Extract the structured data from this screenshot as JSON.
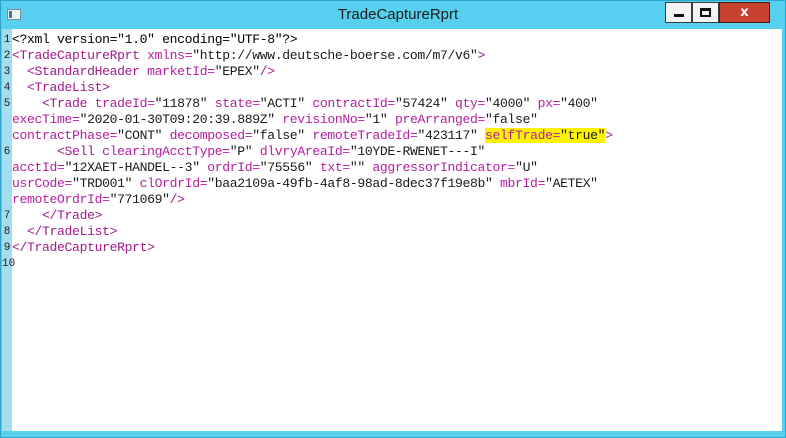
{
  "window": {
    "title": "TradeCaptureRprt",
    "minimize_glyph": "minimize",
    "maximize_glyph": "maximize",
    "close_glyph": "x"
  },
  "editor": {
    "line_numbers": [
      "1",
      "2",
      "3",
      "4",
      "5",
      "6",
      "7",
      "8",
      "9",
      "10"
    ],
    "highlight_color": "#fff200",
    "lines": [
      {
        "text": "<?xml version=\"1.0\" encoding=\"UTF-8\"?>"
      },
      {
        "indent": "",
        "tag": "<TradeCaptureRprt",
        "attrs": [
          [
            "xmlns",
            "http://www.deutsche-boerse.com/m7/v6"
          ]
        ],
        "close": ">"
      },
      {
        "indent": "  ",
        "tag": "<StandardHeader",
        "attrs": [
          [
            "marketId",
            "EPEX"
          ]
        ],
        "close": "/>"
      },
      {
        "indent": "  ",
        "tag": "<TradeList",
        "close": ">"
      },
      {
        "indent": "    ",
        "tag": "<Trade",
        "attrs": [
          [
            "tradeId",
            "11878"
          ],
          [
            "state",
            "ACTI"
          ],
          [
            "contractId",
            "57424"
          ],
          [
            "qty",
            "4000"
          ],
          [
            "px",
            "400"
          ]
        ]
      },
      {
        "attrs": [
          [
            "execTime",
            "2020-01-30T09:20:39.889Z"
          ],
          [
            "revisionNo",
            "1"
          ],
          [
            "preArranged",
            "false"
          ]
        ]
      },
      {
        "attrs": [
          [
            "contractPhase",
            "CONT"
          ],
          [
            "decomposed",
            "false"
          ],
          [
            "remoteTradeId",
            "423117"
          ]
        ],
        "highlight_attr": [
          "selfTrade",
          "true"
        ],
        "close": ">"
      },
      {
        "indent": "      ",
        "tag": "<Sell",
        "attrs": [
          [
            "clearingAcctType",
            "P"
          ],
          [
            "dlvryAreaId",
            "10YDE-RWENET---I"
          ]
        ]
      },
      {
        "attrs": [
          [
            "acctId",
            "12XAET-HANDEL--3"
          ],
          [
            "ordrId",
            "75556"
          ],
          [
            "txt",
            ""
          ],
          [
            "aggressorIndicator",
            "U"
          ]
        ]
      },
      {
        "attrs": [
          [
            "usrCode",
            "TRD001"
          ],
          [
            "clOrdrId",
            "baa2109a-49fb-4af8-98ad-8dec37f19e8b"
          ],
          [
            "mbrId",
            "AETEX"
          ]
        ]
      },
      {
        "attrs": [
          [
            "remoteOrdrId",
            "771069"
          ]
        ],
        "close": "/>"
      },
      {
        "indent": "    ",
        "tag": "</Trade",
        "close": ">"
      },
      {
        "indent": "  ",
        "tag": "</TradeList",
        "close": ">"
      },
      {
        "indent": "",
        "tag": "</TradeCaptureRprt",
        "close": ">"
      },
      {
        "text": ""
      }
    ]
  }
}
